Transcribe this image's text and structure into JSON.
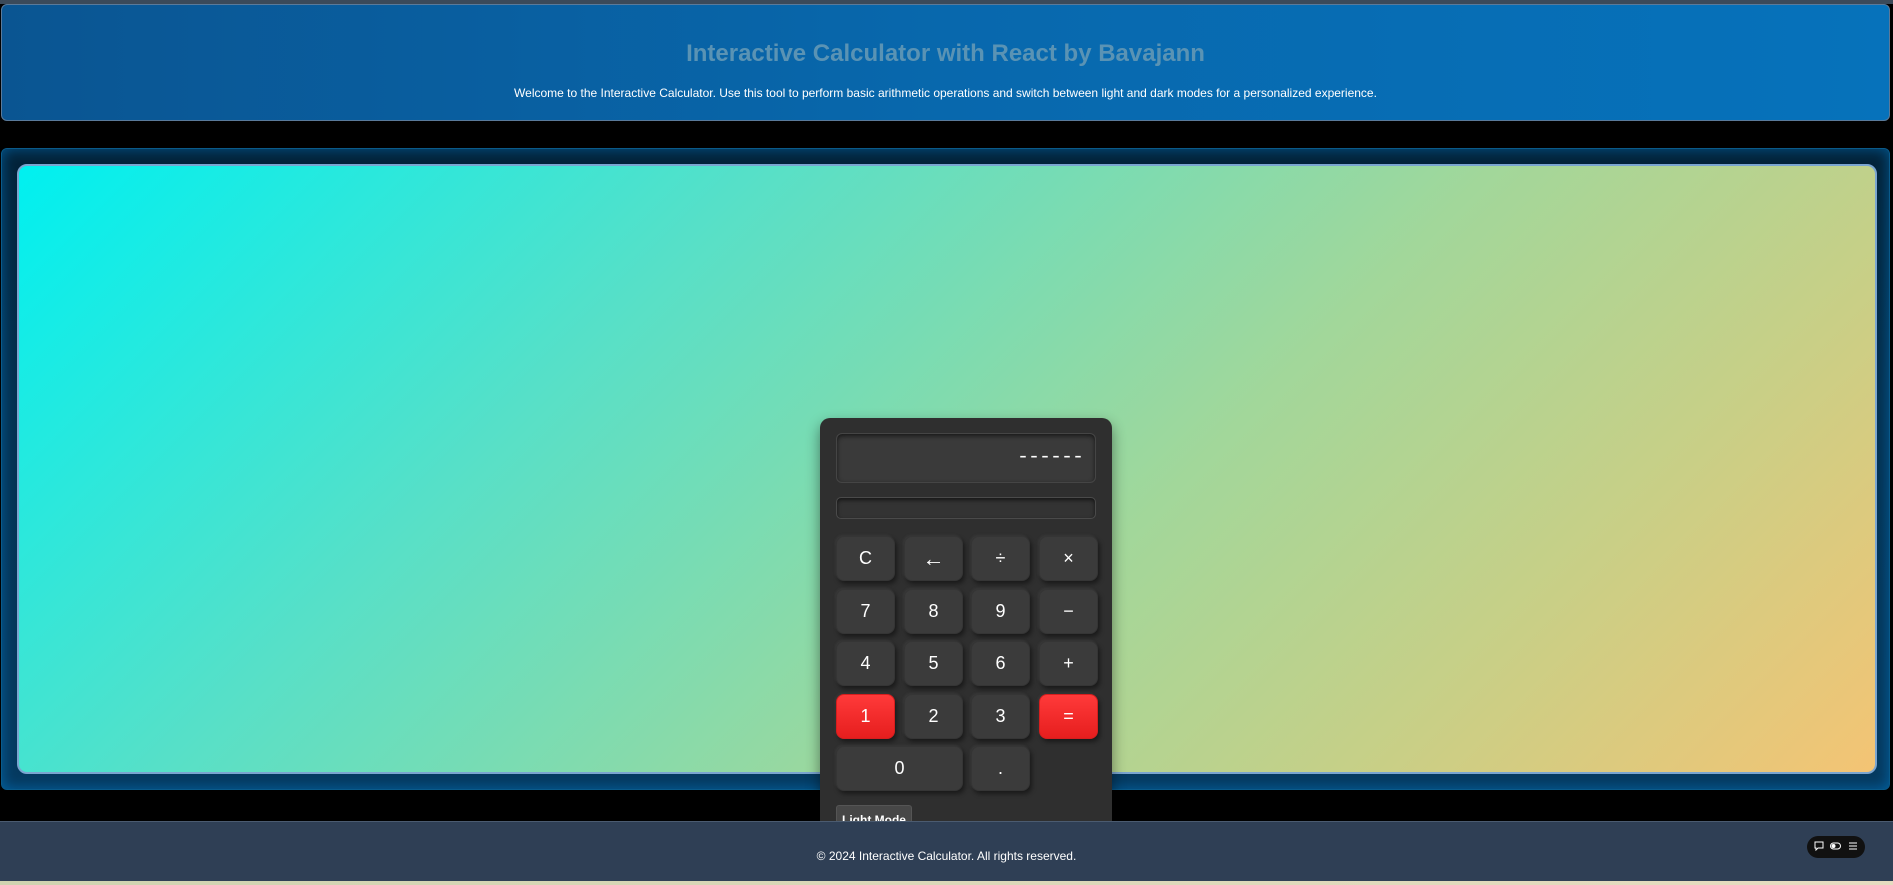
{
  "header": {
    "title": "Interactive Calculator with React by Bavajann",
    "subtitle": "Welcome to the Interactive Calculator. Use this tool to perform basic arithmetic operations and switch between light and dark modes for a personalized experience."
  },
  "calculator": {
    "display": "------",
    "secondary_display": "",
    "keys": {
      "clear": "C",
      "backspace": "←",
      "divide": "÷",
      "multiply": "×",
      "seven": "7",
      "eight": "8",
      "nine": "9",
      "minus": "−",
      "four": "4",
      "five": "5",
      "six": "6",
      "plus": "+",
      "one": "1",
      "two": "2",
      "three": "3",
      "equals": "=",
      "zero": "0",
      "decimal": "."
    },
    "mode_button": "Light Mode"
  },
  "footer": {
    "text": "© 2024 Interactive Calculator. All rights reserved."
  },
  "widget": {
    "icons": [
      "comment-icon",
      "toggle-icon",
      "menu-icon"
    ]
  },
  "colors": {
    "header_bg": "#0868ad",
    "accent_red": "#ff2a2a",
    "calc_bg": "#2f2f2f",
    "footer_bg": "#2f3f55"
  }
}
